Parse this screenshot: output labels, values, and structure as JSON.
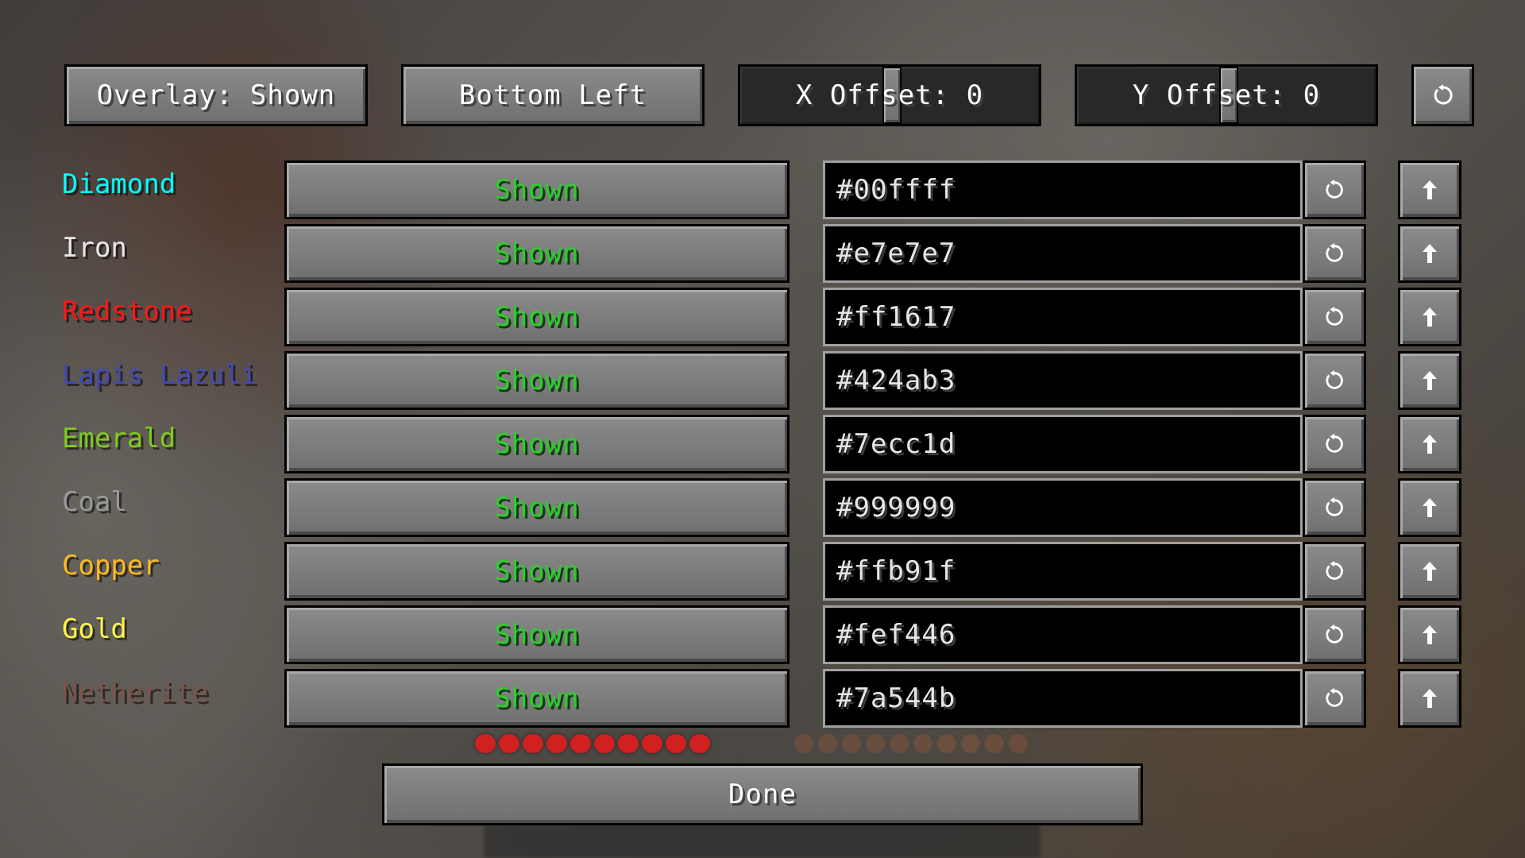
{
  "topbar": {
    "overlay_label": "Overlay: Shown",
    "position_label": "Bottom Left",
    "x_offset_label": "X Offset: 0",
    "y_offset_label": "Y Offset: 0",
    "reset_icon": "reset-icon"
  },
  "ores": [
    {
      "name": "Diamond",
      "color": "#00ffff",
      "status": "Shown",
      "hex": "#00ffff"
    },
    {
      "name": "Iron",
      "color": "#e7e7e7",
      "status": "Shown",
      "hex": "#e7e7e7"
    },
    {
      "name": "Redstone",
      "color": "#ff1617",
      "status": "Shown",
      "hex": "#ff1617"
    },
    {
      "name": "Lapis Lazuli",
      "color": "#424ab3",
      "status": "Shown",
      "hex": "#424ab3"
    },
    {
      "name": "Emerald",
      "color": "#7ecc1d",
      "status": "Shown",
      "hex": "#7ecc1d"
    },
    {
      "name": "Coal",
      "color": "#999999",
      "status": "Shown",
      "hex": "#999999"
    },
    {
      "name": "Copper",
      "color": "#ffb91f",
      "status": "Shown",
      "hex": "#ffb91f"
    },
    {
      "name": "Gold",
      "color": "#fef446",
      "status": "Shown",
      "hex": "#fef446"
    },
    {
      "name": "Netherite",
      "color": "#7a544b",
      "status": "Shown",
      "hex": "#7a544b"
    }
  ],
  "row_icons": {
    "reset": "reset-icon",
    "move_up": "arrow-up-icon"
  },
  "footer": {
    "done_label": "Done"
  }
}
